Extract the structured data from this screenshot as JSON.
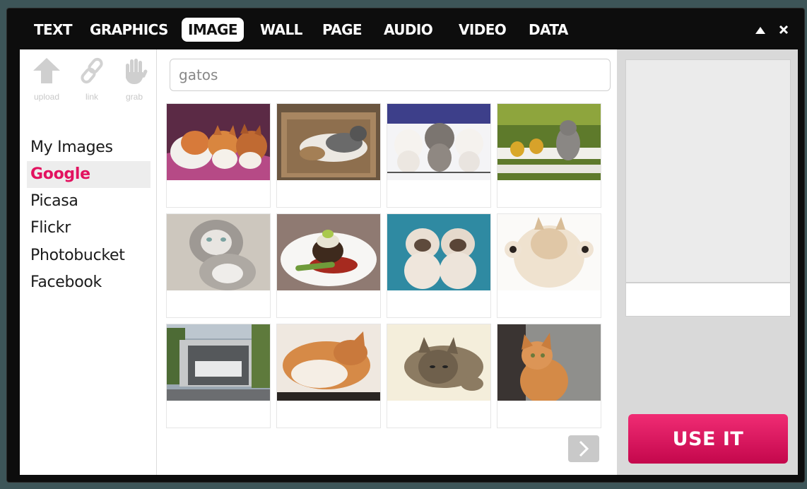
{
  "tabs": [
    {
      "label": "TEXT"
    },
    {
      "label": "GRAPHICS"
    },
    {
      "label": "IMAGE",
      "active": true
    },
    {
      "label": "WALL"
    },
    {
      "label": "PAGE"
    },
    {
      "label": "AUDIO"
    },
    {
      "label": "VIDEO"
    },
    {
      "label": "DATA"
    }
  ],
  "window_controls": {
    "minimize_icon": "up-triangle-icon",
    "close_icon": "close-icon"
  },
  "tools": [
    {
      "label": "upload",
      "icon": "upload-arrow-icon"
    },
    {
      "label": "link",
      "icon": "chain-link-icon"
    },
    {
      "label": "grab",
      "icon": "hand-icon"
    }
  ],
  "sources": [
    {
      "label": "My Images"
    },
    {
      "label": "Google",
      "active": true
    },
    {
      "label": "Picasa"
    },
    {
      "label": "Flickr"
    },
    {
      "label": "Photobucket"
    },
    {
      "label": "Facebook"
    }
  ],
  "search": {
    "value": "gatos"
  },
  "results": [
    {
      "subject": "three kittens on purple blanket"
    },
    {
      "subject": "cat sleeping in cardboard box"
    },
    {
      "subject": "three kittens on blue background"
    },
    {
      "subject": "kitten with ducklings on bench"
    },
    {
      "subject": "two fluffy kittens"
    },
    {
      "subject": "plated food dish"
    },
    {
      "subject": "two himalayan kittens"
    },
    {
      "subject": "fluffy kitten paws up"
    },
    {
      "subject": "glass storefront building"
    },
    {
      "subject": "sleeping orange kitten"
    },
    {
      "subject": "tabby kitten lying down"
    },
    {
      "subject": "orange cat by wall"
    }
  ],
  "pagination": {
    "next_icon": "chevron-right-icon"
  },
  "use_button": {
    "label": "USE IT"
  },
  "colors": {
    "accent": "#e2125f",
    "titlebar": "#0d0d0d",
    "panel": "#d9d9d9"
  }
}
